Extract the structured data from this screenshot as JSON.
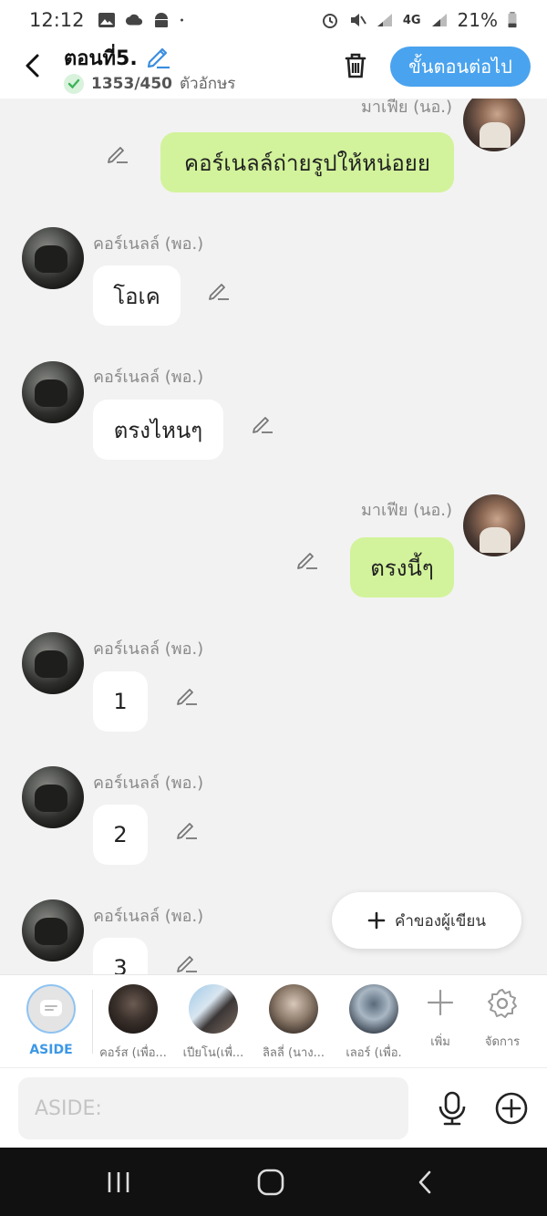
{
  "status_bar": {
    "time": "12:12",
    "network": "4G",
    "battery": "21%"
  },
  "header": {
    "title": "ตอนที่5.",
    "char_count": "1353/450",
    "char_unit": "ตัวอักษร",
    "next_button": "ขั้นตอนต่อไป"
  },
  "messages": [
    {
      "side": "right",
      "name": "มาเฟีย (นอ.)",
      "text": "คอร์เนลล์ถ่ายรูปให้หน่อยย"
    },
    {
      "side": "left",
      "name": "คอร์เนลล์ (พอ.)",
      "text": "โอเค"
    },
    {
      "side": "left",
      "name": "คอร์เนลล์ (พอ.)",
      "text": "ตรงไหนๆ"
    },
    {
      "side": "right",
      "name": "มาเฟีย (นอ.)",
      "text": "ตรงนี้ๆ"
    },
    {
      "side": "left",
      "name": "คอร์เนลล์ (พอ.)",
      "text": "1"
    },
    {
      "side": "left",
      "name": "คอร์เนลล์ (พอ.)",
      "text": "2"
    },
    {
      "side": "left",
      "name": "คอร์เนลล์ (พอ.)",
      "text": "3"
    }
  ],
  "author_button": "คำของผู้เขียน",
  "characters": [
    {
      "label": "ASIDE"
    },
    {
      "label": "คอร์ส (เพื่อ..."
    },
    {
      "label": "เปียโน(เพื่..."
    },
    {
      "label": "ลิลลี่ (นาง..."
    },
    {
      "label": "เลอร์ (เพื่อ."
    }
  ],
  "tools": {
    "add": "เพิ่ม",
    "manage": "จัดการ"
  },
  "input": {
    "placeholder": "ASIDE:"
  },
  "colors": {
    "accent": "#4aa3ee",
    "bubble_right": "#d2f39b",
    "aside_label": "#3c98e6"
  }
}
